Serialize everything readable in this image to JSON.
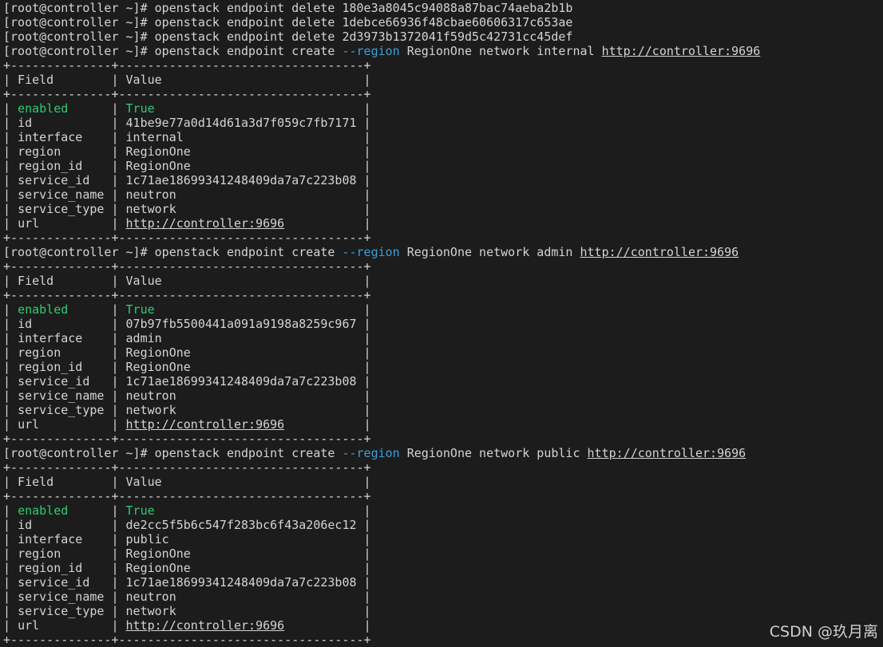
{
  "terminal": {
    "prompt": "[root@controller ~]#",
    "cmd_base": "openstack endpoint",
    "deletes": [
      "180e3a8045c94088a87bac74aeba2b1b",
      "1debce66936f48cbae60606317c653ae",
      "2d3973b1372041f59d5c42731cc45def"
    ],
    "region_flag": "--region",
    "region": "RegionOne",
    "service": "network",
    "url": "http://controller:9696",
    "table_border": "+--------------+----------------------------------+",
    "header": {
      "field": "Field",
      "value": "Value"
    },
    "fields": [
      "enabled",
      "id",
      "interface",
      "region",
      "region_id",
      "service_id",
      "service_name",
      "service_type",
      "url"
    ],
    "blocks": [
      {
        "interface": "internal",
        "values": [
          "True",
          "41be9e77a0d14d61a3d7f059c7fb7171",
          "internal",
          "RegionOne",
          "RegionOne",
          "1c71ae18699341248409da7a7c223b08",
          "neutron",
          "network",
          "http://controller:9696"
        ]
      },
      {
        "interface": "admin",
        "values": [
          "True",
          "07b97fb5500441a091a9198a8259c967",
          "admin",
          "RegionOne",
          "RegionOne",
          "1c71ae18699341248409da7a7c223b08",
          "neutron",
          "network",
          "http://controller:9696"
        ]
      },
      {
        "interface": "public",
        "values": [
          "True",
          "de2cc5f5b6c547f283bc6f43a206ec12",
          "public",
          "RegionOne",
          "RegionOne",
          "1c71ae18699341248409da7a7c223b08",
          "neutron",
          "network",
          "http://controller:9696"
        ]
      }
    ]
  },
  "watermark": "CSDN @玖月离",
  "colors": {
    "background": "#1c1c1c",
    "text": "#d4d4d4",
    "flag": "#3b9fd8",
    "enabled": "#2ecc71"
  }
}
